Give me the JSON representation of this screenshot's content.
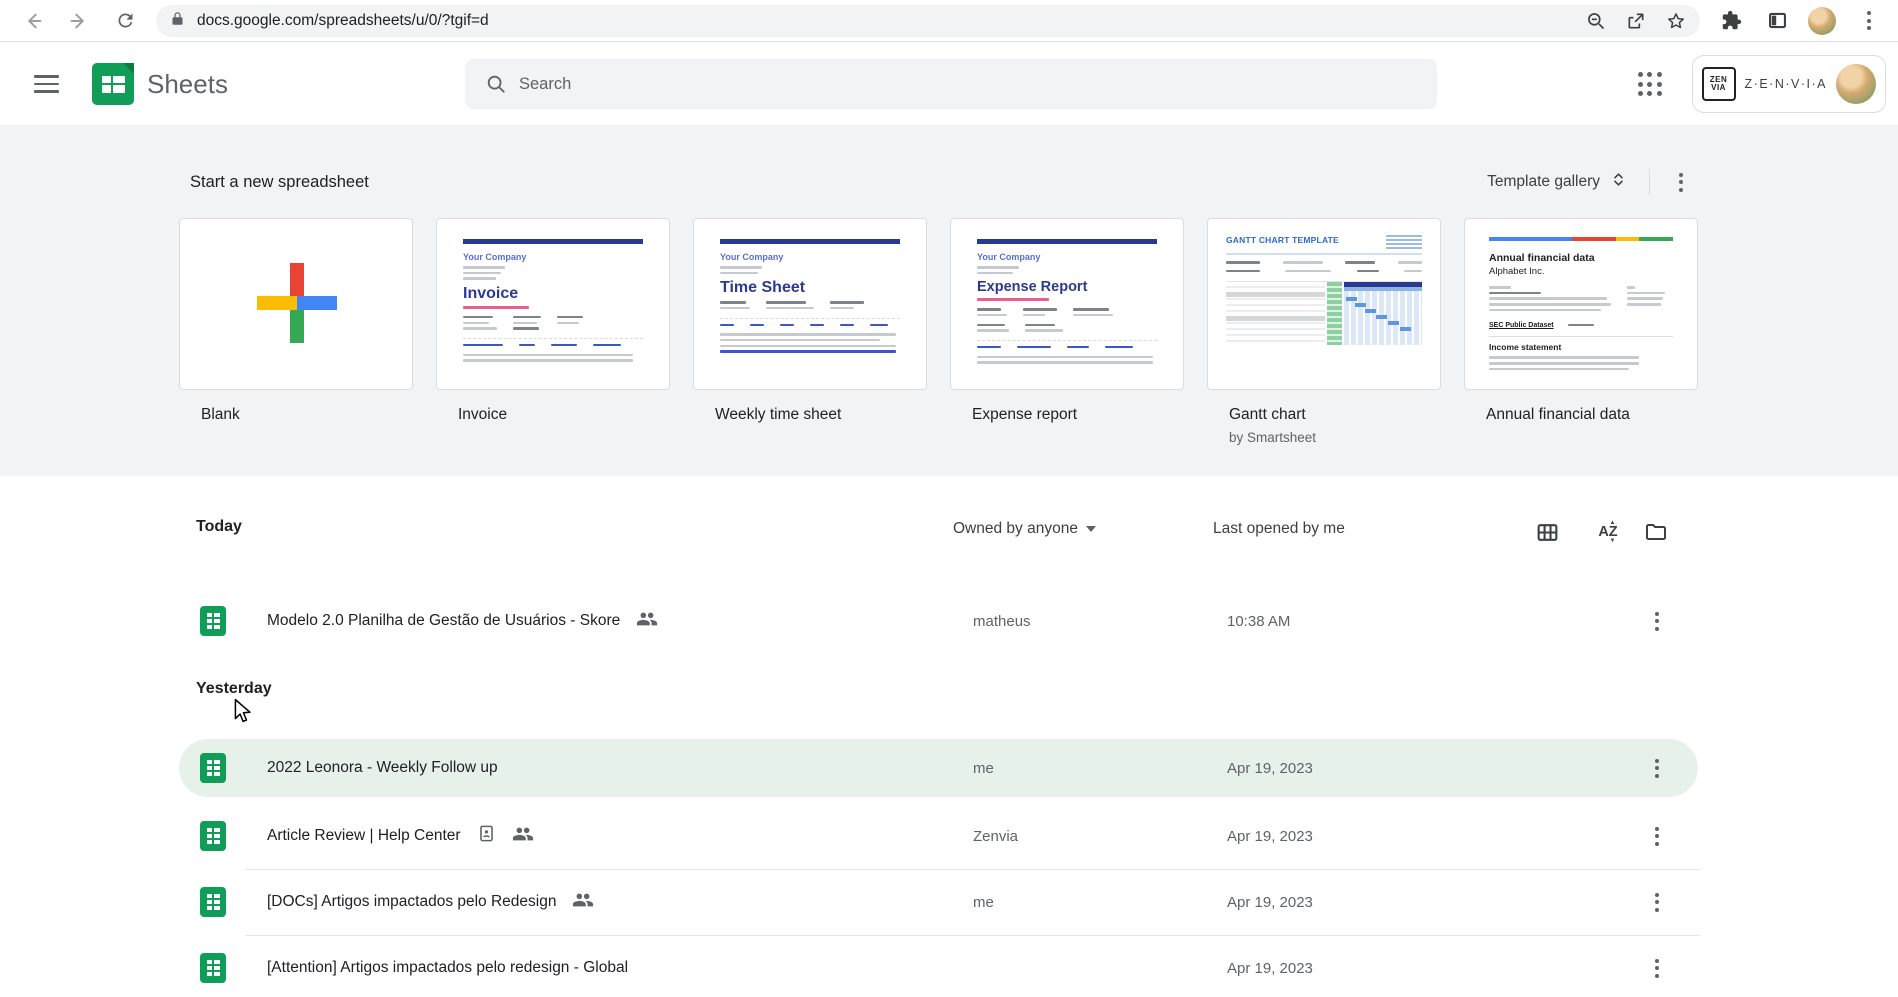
{
  "browser": {
    "url": "docs.google.com/spreadsheets/u/0/?tgif=d"
  },
  "header": {
    "app_name": "Sheets",
    "search_placeholder": "Search",
    "brand_text": "Z·E·N·V·I·A",
    "brand_logo_top": "ZEN",
    "brand_logo_bottom": "VIA"
  },
  "templates": {
    "section_title": "Start a new spreadsheet",
    "gallery_label": "Template gallery",
    "cards": [
      {
        "label": "Blank"
      },
      {
        "label": "Invoice",
        "thumb": {
          "company": "Your Company",
          "title": "Invoice"
        }
      },
      {
        "label": "Weekly time sheet",
        "thumb": {
          "company": "Your Company",
          "title": "Time Sheet"
        }
      },
      {
        "label": "Expense report",
        "thumb": {
          "company": "Your Company",
          "title": "Expense Report"
        }
      },
      {
        "label": "Gantt chart",
        "sublabel": "by Smartsheet",
        "thumb": {
          "title": "GANTT CHART TEMPLATE"
        }
      },
      {
        "label": "Annual financial data",
        "thumb": {
          "title": "Annual financial data",
          "subtitle": "Alphabet Inc.",
          "link": "SEC Public Dataset",
          "section": "Income statement"
        }
      }
    ]
  },
  "filelist": {
    "owner_filter": "Owned by anyone",
    "last_opened_label": "Last opened by me",
    "sections": [
      {
        "label": "Today"
      },
      {
        "label": "Yesterday"
      }
    ],
    "rows": [
      {
        "title": "Modelo 2.0 Planilha de Gestão de Usuários - Skore",
        "owner": "matheus",
        "opened": "10:38 AM"
      },
      {
        "title": "2022 Leonora - Weekly Follow up",
        "owner": "me",
        "opened": "Apr 19, 2023"
      },
      {
        "title": "Article Review | Help Center",
        "owner": "Zenvia",
        "opened": "Apr 19, 2023"
      },
      {
        "title": "[DOCs] Artigos impactados pelo Redesign",
        "owner": "me",
        "opened": "Apr 19, 2023"
      },
      {
        "title": "[Attention] Artigos impactados pelo redesign - Global",
        "opened": "Apr 19, 2023"
      }
    ]
  },
  "colors": {
    "sheets_green": "#0f9d58",
    "highlight_row": "#e6f2e9",
    "template_blue": "#2b3a91"
  }
}
